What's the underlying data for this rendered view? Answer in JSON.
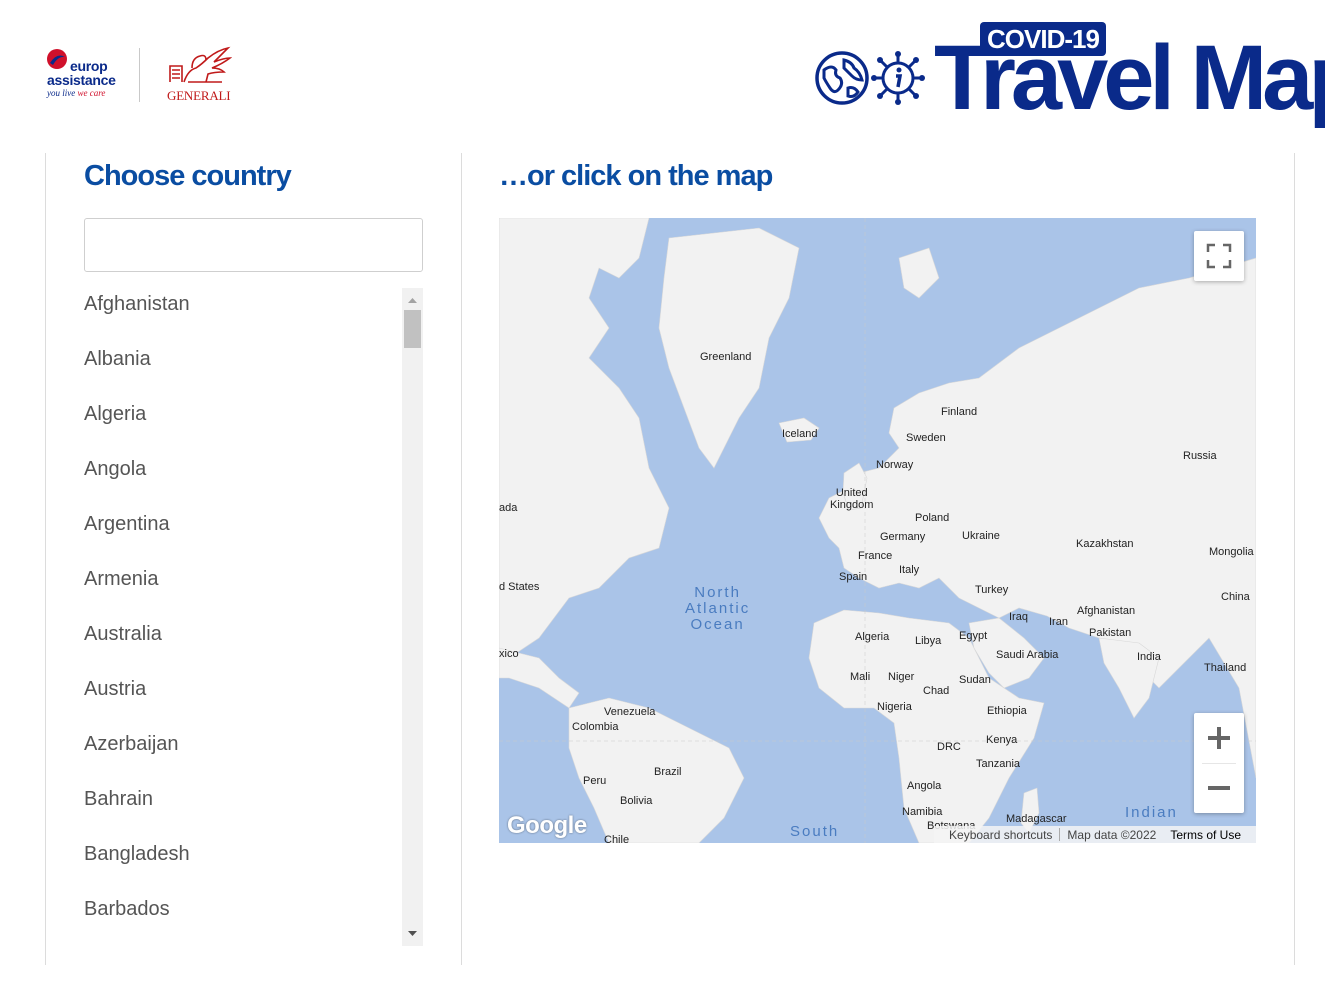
{
  "header": {
    "brand_left": {
      "word1": "europ",
      "word2": "assistance",
      "tagline_blue": "you live",
      "tagline_red": "we care"
    },
    "brand_right": "GENERALI",
    "covid_badge": "COVID-19",
    "title": "Travel Map"
  },
  "left_panel": {
    "title": "Choose country",
    "search": {
      "value": "",
      "placeholder": ""
    },
    "countries": [
      "Afghanistan",
      "Albania",
      "Algeria",
      "Angola",
      "Argentina",
      "Armenia",
      "Australia",
      "Austria",
      "Azerbaijan",
      "Bahrain",
      "Bangladesh",
      "Barbados"
    ]
  },
  "right_panel": {
    "title": "…or click on the map"
  },
  "map": {
    "labels": {
      "greenland": "Greenland",
      "iceland": "Iceland",
      "finland": "Finland",
      "sweden": "Sweden",
      "norway": "Norway",
      "russia": "Russia",
      "uk": "United\nKingdom",
      "canada": "ada",
      "poland": "Poland",
      "germany": "Germany",
      "ukraine": "Ukraine",
      "kazakhstan": "Kazakhstan",
      "mongolia": "Mongolia",
      "france": "France",
      "italy": "Italy",
      "spain": "Spain",
      "us": "d States",
      "turkey": "Turkey",
      "china": "China",
      "iraq": "Iraq",
      "iran": "Iran",
      "afghanistan": "Afghanistan",
      "pakistan": "Pakistan",
      "algeria": "Algeria",
      "libya": "Libya",
      "egypt": "Egypt",
      "saudi": "Saudi Arabia",
      "india": "India",
      "mexico": "xico",
      "thailand": "Thailand",
      "mali": "Mali",
      "niger": "Niger",
      "chad": "Chad",
      "sudan": "Sudan",
      "nigeria": "Nigeria",
      "ethiopia": "Ethiopia",
      "venezuela": "Venezuela",
      "colombia": "Colombia",
      "drc": "DRC",
      "kenya": "Kenya",
      "tanzania": "Tanzania",
      "brazil": "Brazil",
      "peru": "Peru",
      "bolivia": "Bolivia",
      "angola": "Angola",
      "namibia": "Namibia",
      "botswana": "Botswana",
      "madagascar": "Madagascar",
      "chile": "Chile"
    },
    "oceans": {
      "north_atlantic": "North\nAtlantic\nOcean",
      "south": "South",
      "indian": "Indian"
    },
    "google": "Google",
    "attribution": {
      "shortcuts": "Keyboard shortcuts",
      "data": "Map data ©2022",
      "terms": "Terms of Use"
    },
    "colors": {
      "water": "#aac4e8",
      "land": "#f2f2f2"
    }
  },
  "colors": {
    "brand_blue": "#0a2a8a",
    "heading_blue": "#0a4da2",
    "generali_red": "#c01a1a"
  }
}
